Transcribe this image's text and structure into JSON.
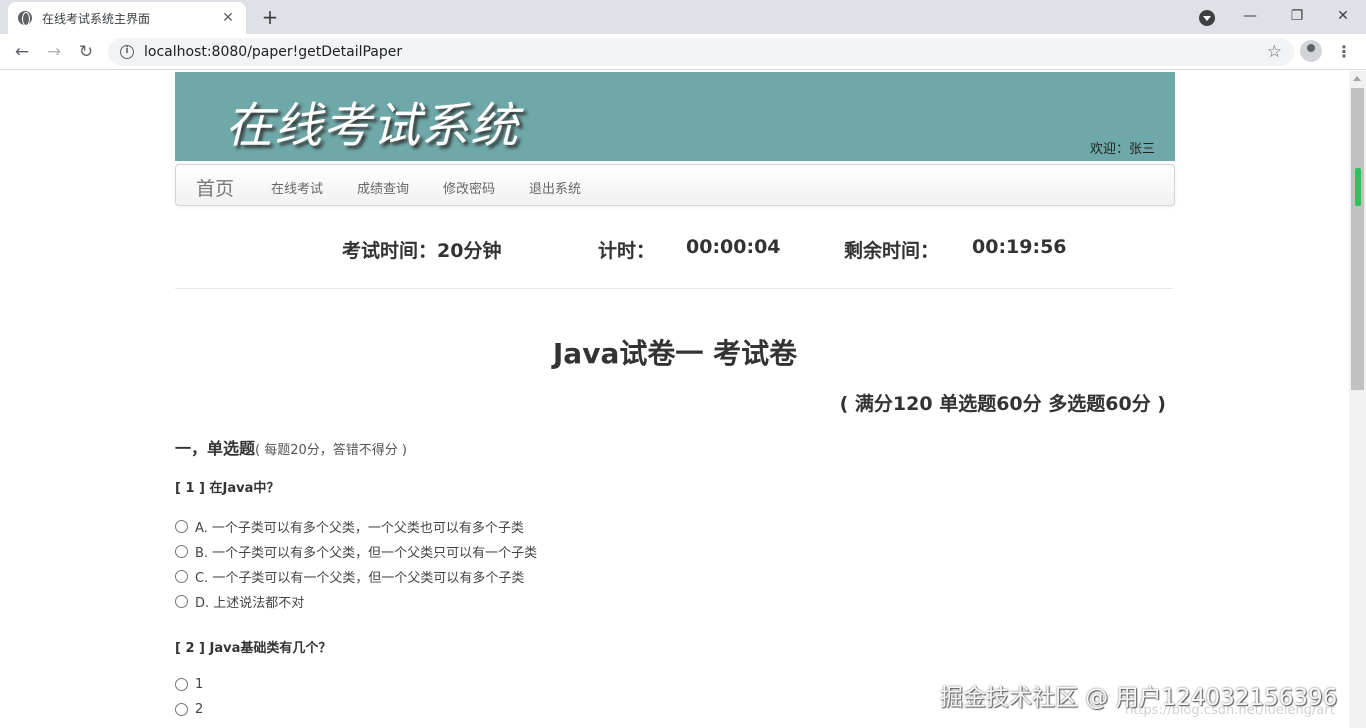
{
  "browser": {
    "tab_title": "在线考试系统主界面",
    "tab_close": "✕",
    "new_tab": "+",
    "url": "localhost:8080/paper!getDetailPaper",
    "minimize": "—",
    "restore": "❐",
    "close": "✕",
    "back": "←",
    "forward": "→",
    "reload": "↻",
    "info": "i",
    "star": "☆",
    "menu": "⋮"
  },
  "header": {
    "logo_text": "在线考试系统",
    "welcome": "欢迎：张三",
    "banner_color": "#6fa8a8"
  },
  "nav": {
    "brand": "首页",
    "items": [
      "在线考试",
      "成绩查询",
      "修改密码",
      "退出系统"
    ]
  },
  "timer": {
    "exam_time": "考试时间：20分钟",
    "elapsed_label": "计时：",
    "elapsed_value": "00:00:04",
    "remaining_label": "剩余时间：",
    "remaining_value": "00:19:56"
  },
  "paper": {
    "title": "Java试卷一  考试卷",
    "score": "( 满分120  单选题60分  多选题60分 )"
  },
  "section": {
    "title": "一，单选题",
    "note": "( 每题20分，答错不得分 )"
  },
  "questions": [
    {
      "text": "[ 1 ] 在Java中？",
      "options": [
        "A. 一个子类可以有多个父类，一个父类也可以有多个子类",
        "B. 一个子类可以有多个父类，但一个父类只可以有一个子类",
        "C. 一个子类可以有一个父类，但一个父类可以有多个子类",
        "D. 上述说法都不对"
      ]
    },
    {
      "text": "[ 2 ] Java基础类有几个？",
      "options": [
        "1",
        "2"
      ]
    }
  ],
  "watermark": {
    "main": "掘金技术社区 @ 用户124032156396",
    "sub": "https://blog.csdn.net/lueleng/art"
  }
}
